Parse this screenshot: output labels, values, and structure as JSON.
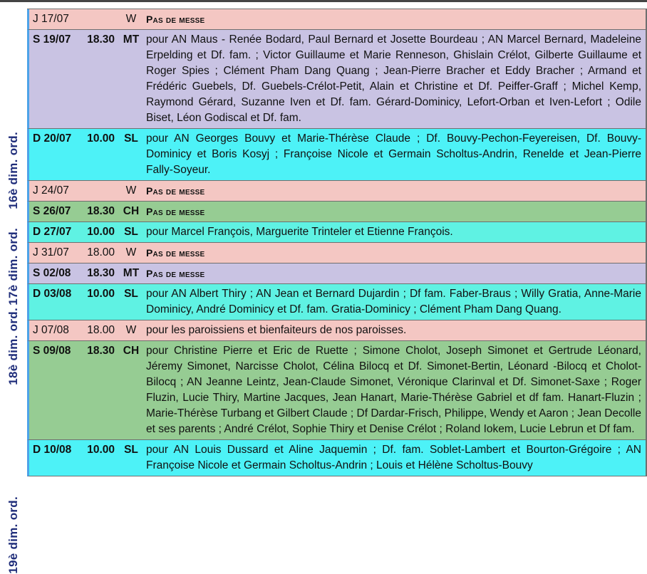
{
  "weeks": [
    {
      "label": "16è dim. ord."
    },
    {
      "label": "17è dim. ord."
    },
    {
      "label": "18è dim. ord."
    },
    {
      "label": "19è dim. ord."
    }
  ],
  "rows": [
    {
      "date": "J 17/07",
      "time": "",
      "church": "W",
      "text": "Pas de messe",
      "bg": "#f4c7c3"
    },
    {
      "date": "S 19/07",
      "time": "18.30",
      "church": "MT",
      "text": "pour AN Maus - Renée Bodard, Paul Bernard et Josette Bourdeau ; AN Marcel Bernard, Madeleine Erpelding et Df. fam. ; Victor Guillaume et Marie Renneson, Ghislain Crélot, Gilberte Guillaume et Roger Spies ; Clément Pham Dang Quang ; Jean-Pierre Bracher et Eddy Bracher ; Armand et Frédéric Guebels, Df. Guebels-Crélot-Petit, Alain et Christine et Df. Peiffer-Graff ; Michel Kemp, Raymond Gérard, Suzanne Iven et Df. fam. Gérard-Dominicy, Lefort-Orban et Iven-Lefort ; Odile Biset, Léon Godiscal et Df. fam.",
      "bg": "#c9c3e3"
    },
    {
      "date": "D 20/07",
      "time": "10.00",
      "church": "SL",
      "text": "pour AN Georges Bouvy et Marie-Thérèse Claude ; Df. Bouvy-Pechon-Feyereisen, Df. Bouvy-Dominicy et Boris Kosyj ; Françoise Nicole et Germain Scholtus-Andrin, Renelde et Jean-Pierre Fally-Soyeur.",
      "bg": "#4df2f7"
    },
    {
      "date": "J 24/07",
      "time": "",
      "church": "W",
      "text": "Pas de messe",
      "bg": "#f4c7c3"
    },
    {
      "date": "S 26/07",
      "time": "18.30",
      "church": "CH",
      "text": "Pas de messe",
      "bg": "#96cc93"
    },
    {
      "date": "D 27/07",
      "time": "10.00",
      "church": "SL",
      "text": "pour Marcel François, Marguerite Trinteler et Etienne François.",
      "bg": "#5ff2e3"
    },
    {
      "date": "J 31/07",
      "time": "18.00",
      "church": "W",
      "text": "Pas de messe",
      "bg": "#f4c7c3"
    },
    {
      "date": "S 02/08",
      "time": "18.30",
      "church": "MT",
      "text": "Pas de messe",
      "bg": "#c9c3e3"
    },
    {
      "date": "D 03/08",
      "time": "10.00",
      "church": "SL",
      "text": "pour AN Albert Thiry ; AN Jean et Bernard Dujardin ; Df fam. Faber-Braus ; Willy Gratia, Anne-Marie Dominicy, André Dominicy et Df. fam. Gratia-Dominicy ; Clément Pham Dang Quang.",
      "bg": "#5ff2e3"
    },
    {
      "date": "J 07/08",
      "time": "18.00",
      "church": "W",
      "text": "pour les paroissiens et bienfaiteurs de nos paroisses.",
      "bg": "#f4c7c3"
    },
    {
      "date": "S 09/08",
      "time": "18.30",
      "church": "CH",
      "text": "pour Christine Pierre et Eric de Ruette ; Simone Cholot, Joseph Simonet et Gertrude Léonard, Jéremy Simonet, Narcisse Cholot, Célina Bilocq et Df. Simonet-Bertin, Léonard -Bilocq et Cholot-Bilocq ; AN Jeanne Leintz, Jean-Claude Simonet, Véronique Clarinval et Df. Simonet-Saxe ; Roger Fluzin, Lucie Thiry, Martine Jacques, Jean Hanart, Marie-Thérèse Gabriel et df fam. Hanart-Fluzin ; Marie-Thérèse Turbang et Gilbert Claude ; Df Dardar-Frisch, Philippe, Wendy et Aaron ; Jean Decolle et ses parents ; André Crélot, Sophie Thiry et Denise Crélot ; Roland Iokem, Lucie Lebrun et Df fam.",
      "bg": "#96cc93"
    },
    {
      "date": "D 10/08",
      "time": "10.00",
      "church": "SL",
      "text": "pour AN Louis Dussard et Aline Jaquemin ; Df. fam. Soblet-Lambert et Bourton-Grégoire ; AN Françoise Nicole et Germain Scholtus-Andrin ; Louis et Hélène Scholtus-Bouvy",
      "bg": "#4df2f7"
    }
  ]
}
